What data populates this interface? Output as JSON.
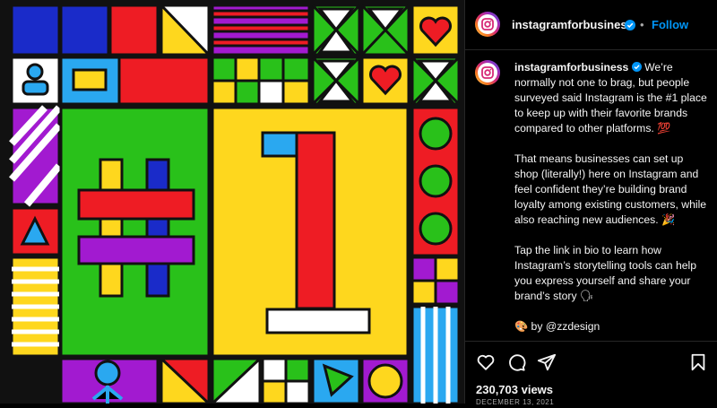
{
  "post": {
    "image_alt": "Colorful geometric tile artwork featuring #1"
  },
  "header": {
    "username": "instagramforbusiness",
    "separator": "•",
    "follow_label": "Follow"
  },
  "caption": {
    "username": "instagramforbusiness",
    "paragraphs": [
      "We’re normally not one to brag, but people surveyed said Instagram is the #1 place to keep up with their favorite brands compared to other platforms. 💯",
      "That means businesses can set up shop (literally!) here on Instagram and feel confident they’re building brand loyalty among existing customers, while also reaching new audiences. 🎉",
      "Tap the link in bio to learn how Instagram’s storytelling tools can help you express yourself and share your brand’s story 🗣",
      "🎨 by @zzdesign"
    ]
  },
  "stats": {
    "views": "230,703 views",
    "date": "DECEMBER 13, 2021"
  },
  "icons": {
    "like": "heart-icon",
    "comment": "comment-icon",
    "share": "share-icon",
    "save": "bookmark-icon",
    "verified": "verified-badge-icon",
    "avatar": "instagram-logo-icon"
  },
  "colors": {
    "background": "#000000",
    "text": "#f5f5f5",
    "muted": "#a8a8a8",
    "accent": "#0095f6",
    "verified": "#0095f6",
    "art_red": "#ee1c24",
    "art_yellow": "#fed71e",
    "art_green": "#29c11a",
    "art_blue": "#1a2bc9",
    "art_purple": "#a21ad0",
    "art_cyan": "#2aa8f0"
  }
}
